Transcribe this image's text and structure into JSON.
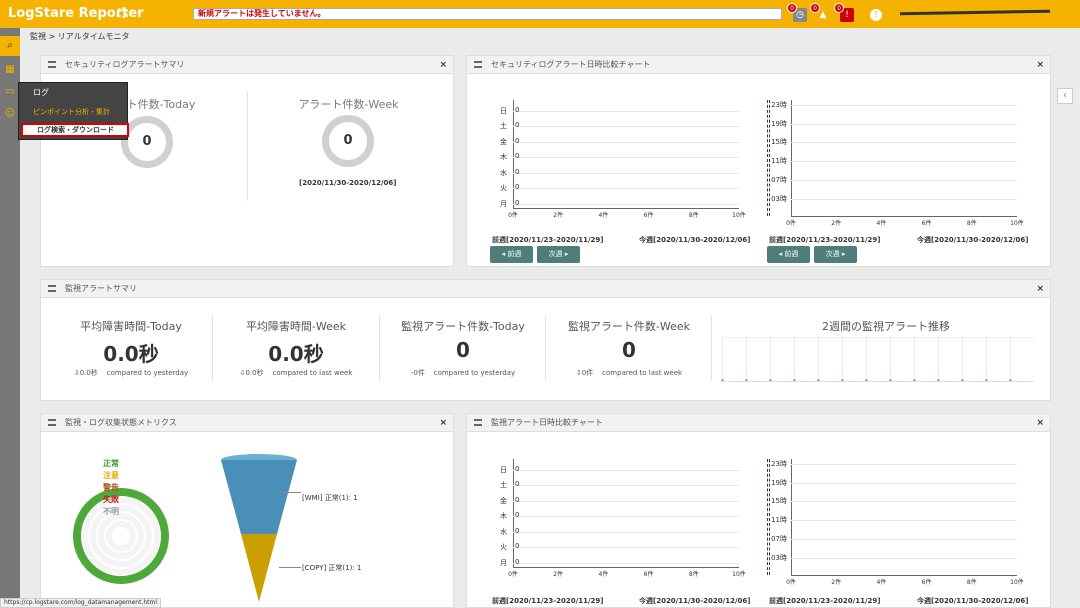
{
  "header": {
    "brand": "LogStare Reporter",
    "alert_message": "新規アラートは発生していません。",
    "badges": [
      "0",
      "0",
      "0"
    ]
  },
  "breadcrumb": "監視 > リアルタイムモニタ",
  "sidebar_menu": {
    "header": "ログ",
    "item1": "ピンポイント分析・集計",
    "item2": "ログ検索・ダウンロード"
  },
  "security_summary": {
    "title": "セキュリティログアラートサマリ",
    "today_title": "ト件数-Today",
    "today_value": "0",
    "week_title": "アラート件数-Week",
    "week_value": "0",
    "week_period": "[2020/11/30-2020/12/06]"
  },
  "security_chart": {
    "title": "セキュリティログアラート日時比較チャート",
    "days": [
      "日",
      "土",
      "金",
      "木",
      "水",
      "火",
      "月"
    ],
    "day_values": [
      "0",
      "0",
      "0",
      "0",
      "0",
      "0",
      "0"
    ],
    "x_ticks": [
      "0件",
      "2件",
      "4件",
      "6件",
      "8件",
      "10件"
    ],
    "hours": [
      "23時",
      "19時",
      "15時",
      "11時",
      "07時",
      "03時"
    ],
    "prev_week": "前週[2020/11/23-2020/11/29]",
    "this_week": "今週[2020/11/30-2020/12/06]",
    "prev_btn": "前週",
    "next_btn": "次週"
  },
  "monitor_summary": {
    "title": "監視アラートサマリ",
    "stats": [
      {
        "title": "平均障害時間-Today",
        "value": "0.0秒",
        "delta": "0.0秒",
        "compare": "compared to yesterday"
      },
      {
        "title": "平均障害時間-Week",
        "value": "0.0秒",
        "delta": "0.0秒",
        "compare": "compared to last week"
      },
      {
        "title": "監視アラート件数-Today",
        "value": "0",
        "delta": "0件",
        "compare": "compared to yesterday"
      },
      {
        "title": "監視アラート件数-Week",
        "value": "0",
        "delta": "0件",
        "compare": "compared to last week"
      }
    ],
    "trend_title": "2週間の監視アラート推移"
  },
  "metrics": {
    "title": "監視・ログ収集状態メトリクス",
    "legend": [
      "正常",
      "注意",
      "警告",
      "失敗",
      "不明"
    ],
    "legend_colors": [
      "#3a9a2a",
      "#e0b000",
      "#b05020",
      "#c02020",
      "#999999"
    ],
    "funnel_labels": [
      "[WMI] 正常(1): 1",
      "[COPY] 正常(1): 1"
    ]
  },
  "monitor_chart": {
    "title": "監視アラート日時比較チャート",
    "prev_week": "前週[2020/11/23-2020/11/29]",
    "this_week": "今週[2020/11/30-2020/12/06]"
  },
  "status_url": "https://cp.logstare.com/log_datamanagement.html"
}
